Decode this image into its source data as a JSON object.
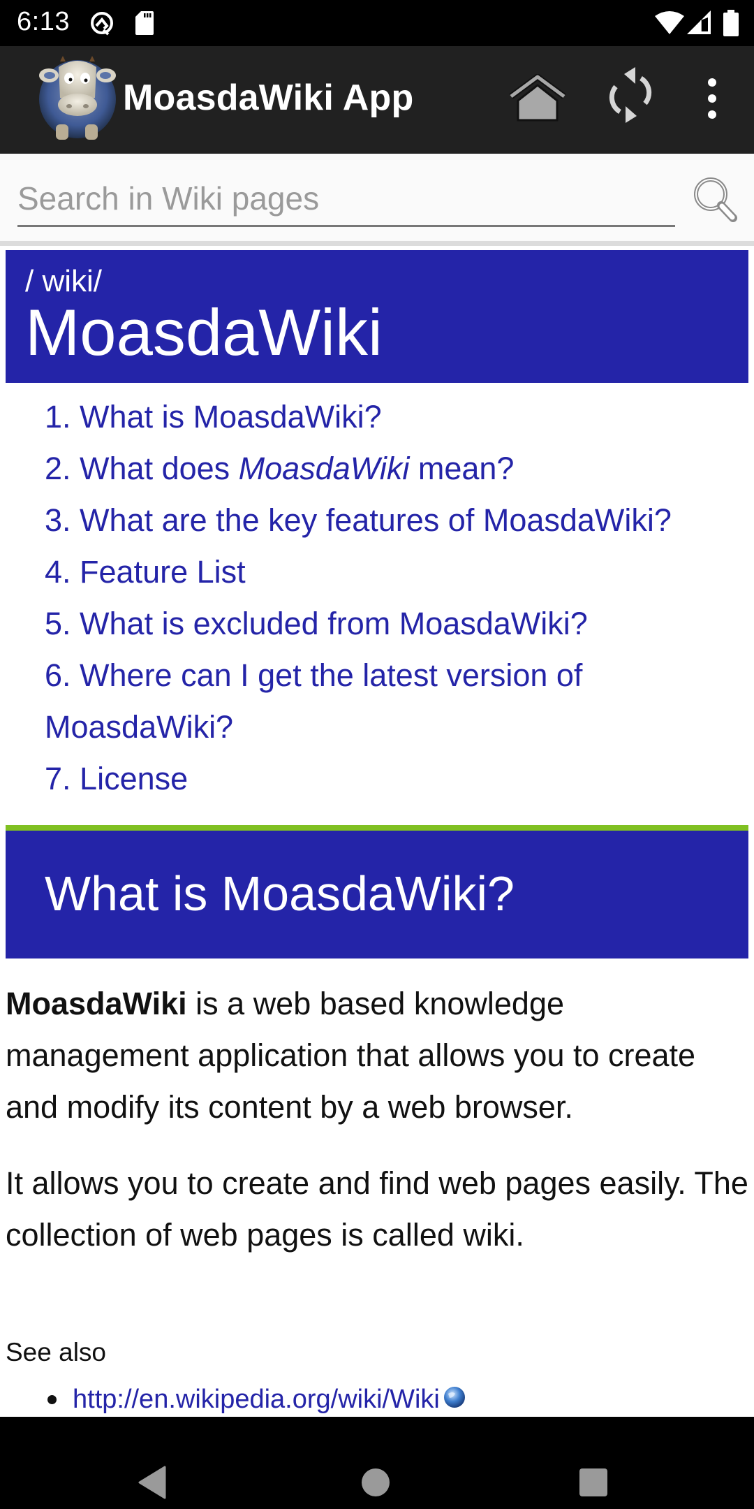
{
  "status_bar": {
    "time": "6:13",
    "left_icons": [
      "q-notification-icon",
      "sd-card-icon"
    ],
    "right_icons": [
      "wifi-icon",
      "cell-signal-icon",
      "battery-icon"
    ]
  },
  "app_bar": {
    "title": "MoasdaWiki App",
    "logo": "cow-figurine-logo",
    "actions": [
      "home-icon",
      "sync-icon",
      "more-vert-icon"
    ]
  },
  "search": {
    "placeholder": "Search in Wiki pages",
    "value": "",
    "icon": "search-icon"
  },
  "page": {
    "breadcrumb": "/ wiki/",
    "title": "MoasdaWiki",
    "toc": [
      {
        "number": "1.",
        "pre": "What is MoasdaWiki?",
        "em": "",
        "post": ""
      },
      {
        "number": "2.",
        "pre": "What does ",
        "em": "MoasdaWiki",
        "post": " mean?"
      },
      {
        "number": "3.",
        "pre": "What are the key features of MoasdaWiki?",
        "em": "",
        "post": ""
      },
      {
        "number": "4.",
        "pre": "Feature List",
        "em": "",
        "post": ""
      },
      {
        "number": "5.",
        "pre": "What is excluded from MoasdaWiki?",
        "em": "",
        "post": ""
      },
      {
        "number": "6.",
        "pre": "Where can I get the latest version of MoasdaWiki?",
        "em": "",
        "post": ""
      },
      {
        "number": "7.",
        "pre": "License",
        "em": "",
        "post": ""
      }
    ],
    "section": {
      "title": "What is MoasdaWiki?",
      "para1_bold": "MoasdaWiki",
      "para1_rest": " is a web based knowledge management application that allows you to create and modify its content by a web browser.",
      "para2": "It allows you to create and find web pages easily. The collection of web pages is called wiki.",
      "see_also_label": "See also",
      "see_also_links": [
        {
          "text": "http://en.wikipedia.org/wiki/Wiki",
          "icon": "globe-icon"
        }
      ]
    }
  },
  "colors": {
    "accent_blue": "#2424a8",
    "rule_green": "#80c022",
    "app_bar": "#212121"
  },
  "nav_bar": {
    "buttons": [
      "back",
      "home",
      "recents"
    ]
  }
}
